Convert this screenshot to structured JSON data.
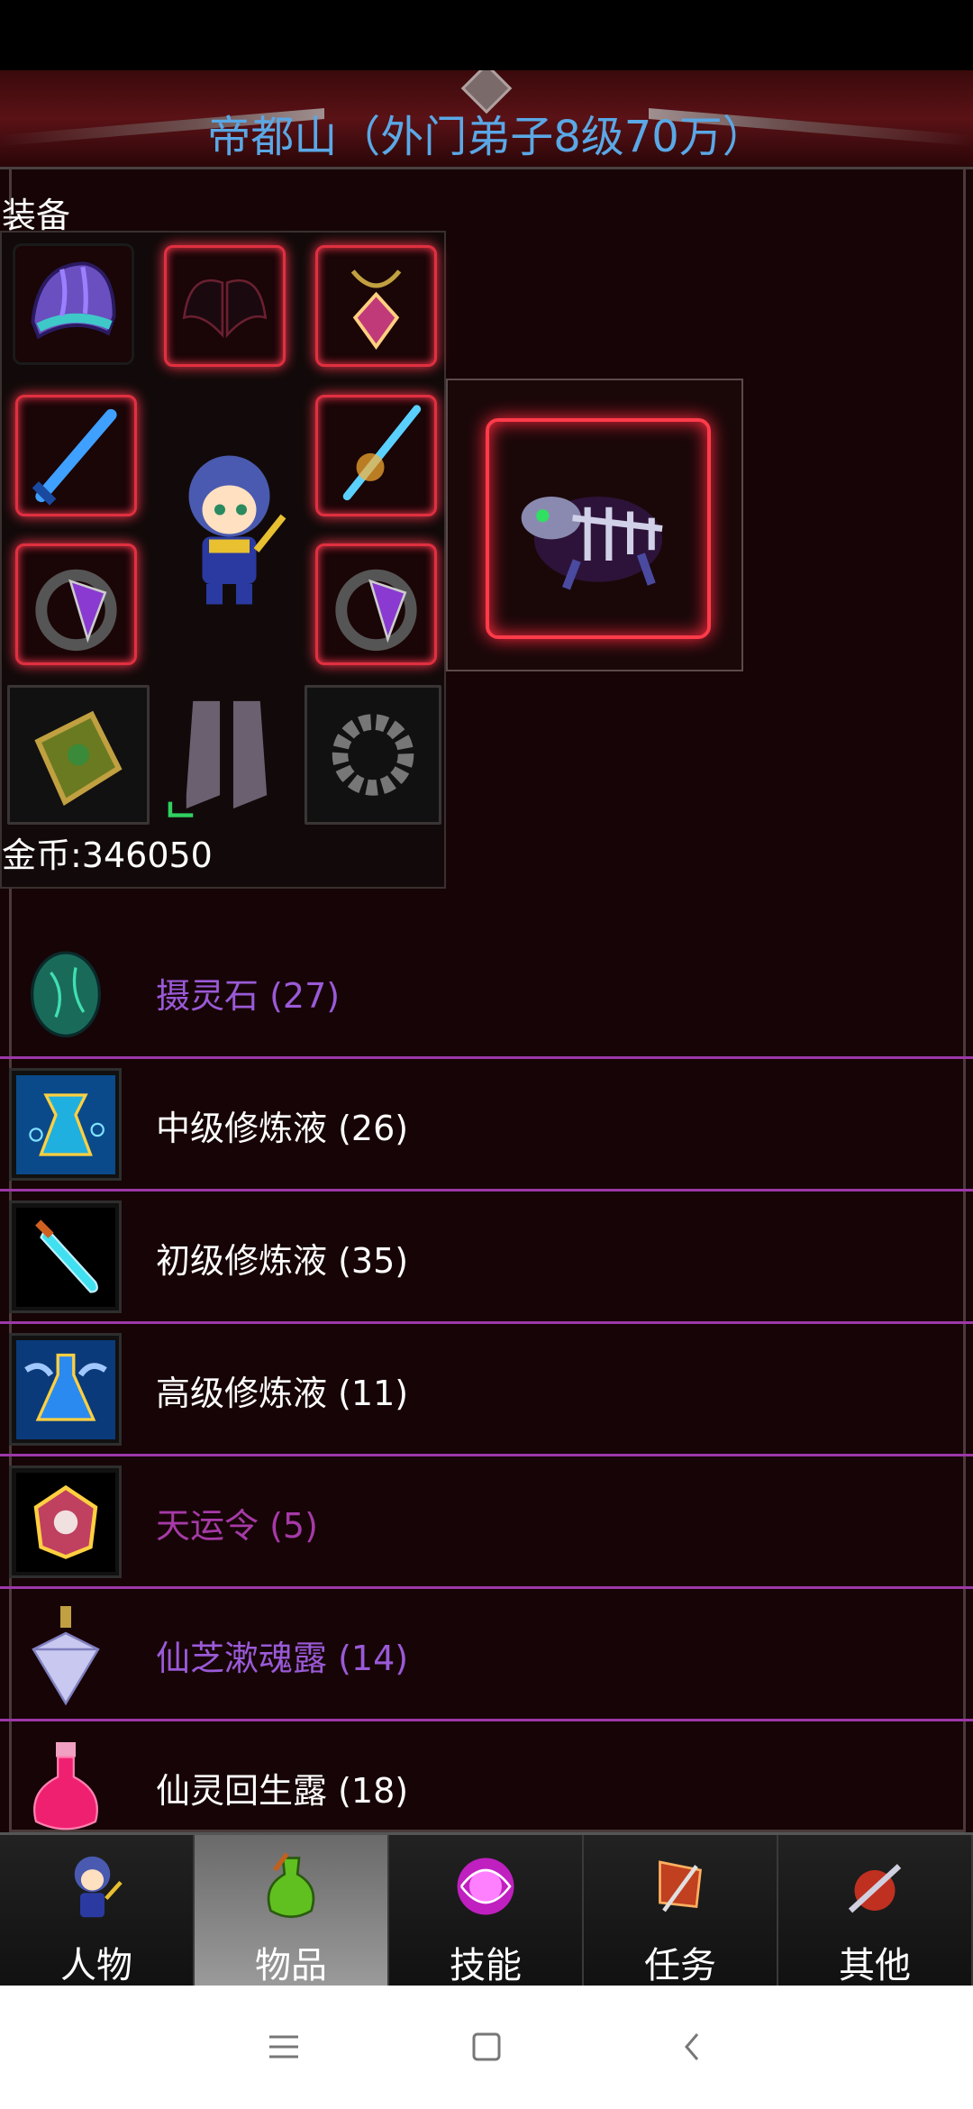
{
  "header": {
    "title": "帝都山（外门弟子8级70万）"
  },
  "equipment": {
    "label": "装备",
    "slots": [
      {
        "name": "helmet",
        "icon": "helmet-icon"
      },
      {
        "name": "wings",
        "icon": "wings-icon"
      },
      {
        "name": "necklace",
        "icon": "necklace-icon"
      },
      {
        "name": "sword-left",
        "icon": "sword-icon"
      },
      {
        "name": "spear-right",
        "icon": "spear-icon"
      },
      {
        "name": "ring-left",
        "icon": "ring-icon"
      },
      {
        "name": "ring-right",
        "icon": "ring-icon"
      },
      {
        "name": "bracer",
        "icon": "bracer-icon"
      },
      {
        "name": "boots",
        "icon": "boots-icon"
      },
      {
        "name": "bead-bracelet",
        "icon": "bead-bracelet-icon"
      }
    ],
    "pet": {
      "icon": "skeleton-beast-icon"
    }
  },
  "gold": {
    "text": "金币:346050"
  },
  "items": [
    {
      "name": "摄灵石 (27)",
      "color": "#9a5ad8",
      "icon": "green-egg-icon"
    },
    {
      "name": "中级修炼液 (26)",
      "color": "#ffffff",
      "icon": "blue-flask-icon"
    },
    {
      "name": "初级修炼液 (35)",
      "color": "#ffffff",
      "icon": "test-tube-icon"
    },
    {
      "name": "高级修炼液 (11)",
      "color": "#ffffff",
      "icon": "winged-potion-icon"
    },
    {
      "name": "天运令 (5)",
      "color": "#a63aa8",
      "icon": "token-icon"
    },
    {
      "name": "仙芝漱魂露 (14)",
      "color": "#9a5ad8",
      "icon": "crystal-bottle-icon"
    },
    {
      "name": "仙灵回生露 (18)",
      "color": "#ffffff",
      "icon": "pink-potion-icon"
    }
  ],
  "tabs": [
    {
      "label": "人物",
      "icon": "character-icon",
      "active": false
    },
    {
      "label": "物品",
      "icon": "potion-bag-icon",
      "active": true
    },
    {
      "label": "技能",
      "icon": "skill-orb-icon",
      "active": false
    },
    {
      "label": "任务",
      "icon": "quest-flag-icon",
      "active": false
    },
    {
      "label": "其他",
      "icon": "sword-emblem-icon",
      "active": false
    }
  ],
  "colors": {
    "accent": "#9c38a8",
    "title": "#5aa8e6",
    "slot_glow": "#ff3a50"
  }
}
